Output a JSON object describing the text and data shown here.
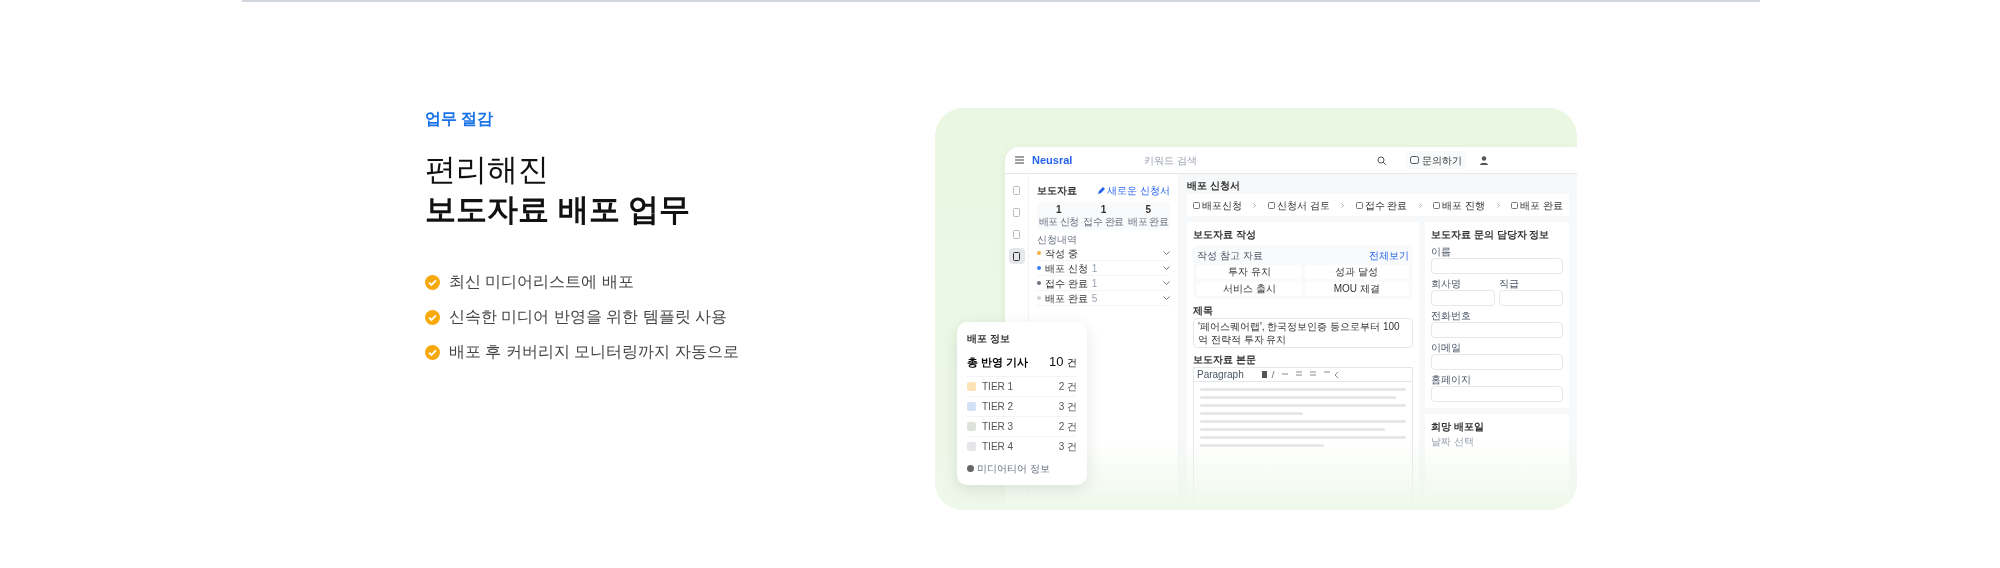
{
  "section_label": "업무 절감",
  "headline": {
    "light": "편리해진",
    "bold": "보도자료 배포 업무"
  },
  "features": [
    "최신 미디어리스트에 배포",
    "신속한 미디어 반영을 위한 템플릿 사용",
    "배포 후 커버리지 모니터링까지 자동으로"
  ],
  "app": {
    "logo": "Neusral",
    "search": {
      "placeholder": "키워드 검색"
    },
    "contact_button": "문의하기",
    "rail": [
      {
        "selected": false
      },
      {
        "selected": false
      },
      {
        "selected": false
      },
      {
        "selected": true
      }
    ],
    "list_panel": {
      "title": "보도자료",
      "new_link": "새로운 신청서",
      "stats": [
        {
          "value": "1",
          "label": "배포 신청"
        },
        {
          "value": "1",
          "label": "접수 완료"
        },
        {
          "value": "5",
          "label": "배포 완료"
        }
      ],
      "group_label": "신청내역",
      "items": [
        {
          "label": "작성 중",
          "color": "#f5b041"
        },
        {
          "label": "배포 신청",
          "count": "1",
          "color": "#3b82f6"
        },
        {
          "label": "접수 완료",
          "count": "1",
          "color": "#6b7280"
        },
        {
          "label": "배포 완료",
          "count": "5",
          "color": "#d1d5db"
        }
      ]
    },
    "page_title": "배포 신청서",
    "steps": [
      "배포신청",
      "신청서 검토",
      "접수 완료",
      "배포 진행",
      "배포 완료"
    ],
    "compose": {
      "title": "보도자료 작성",
      "reference_label": "작성 참고 자료",
      "view_all": "전체보기",
      "chips": [
        "투자 유치",
        "성과 달성",
        "서비스 출시",
        "MOU 체결"
      ],
      "subject_label": "제목",
      "subject_value": "'페어스퀘어랩', 한국정보인증 등으로부터 100억 전략적 투자 유치",
      "body_label": "보도자료 본문",
      "format_select": "Paragraph"
    },
    "contact_form": {
      "title": "보도자료 문의 담당자 정보",
      "fields": [
        "이름",
        "회사명",
        "직급",
        "전화번호",
        "이메일",
        "홈페이지"
      ]
    },
    "date_card": {
      "title": "희망 배포일",
      "placeholder": "날짜 선택"
    }
  },
  "popup": {
    "title": "배포 정보",
    "total_label": "총 반영 기사",
    "total_value": "10",
    "unit": "건",
    "tiers": [
      {
        "name": "TIER 1",
        "count": "2 건",
        "color": "#fde2b8"
      },
      {
        "name": "TIER 2",
        "count": "3 건",
        "color": "#d4e0f5"
      },
      {
        "name": "TIER 3",
        "count": "2 건",
        "color": "#dde3d8"
      },
      {
        "name": "TIER 4",
        "count": "3 건",
        "color": "#e6e6ea"
      }
    ],
    "footer": "미디어티어 정보"
  }
}
